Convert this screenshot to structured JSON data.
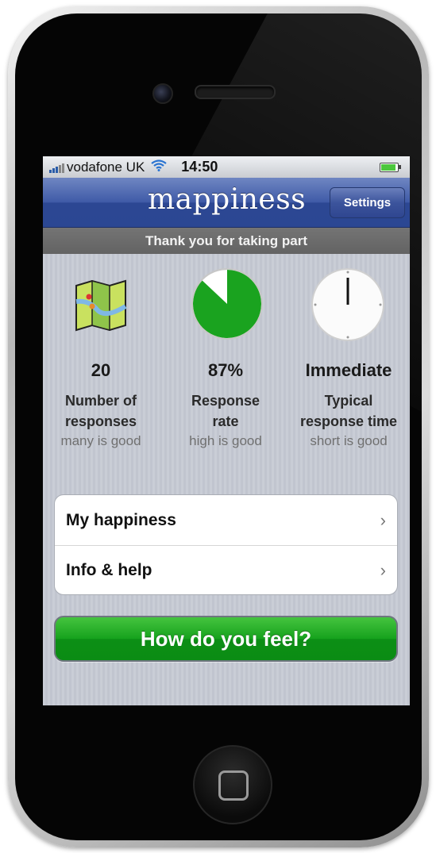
{
  "status_bar": {
    "carrier": "vodafone UK",
    "time": "14:50",
    "wifi_icon": "wifi-icon",
    "signal_icon": "signal-bars-icon",
    "battery_icon": "battery-icon",
    "battery_level": 0.9
  },
  "header": {
    "title": "mappiness",
    "settings_label": "Settings"
  },
  "banner": {
    "text": "Thank you for taking part"
  },
  "stats": [
    {
      "icon": "map-icon",
      "value": "20",
      "label_line1": "Number of",
      "label_line2": "responses",
      "hint": "many is good"
    },
    {
      "icon": "pie-chart-icon",
      "value": "87%",
      "label_line1": "Response",
      "label_line2": "rate",
      "hint": "high is good",
      "fill_fraction": 0.87
    },
    {
      "icon": "clock-icon",
      "value": "Immediate",
      "label_line1": "Typical",
      "label_line2": "response time",
      "hint": "short is good"
    }
  ],
  "menu": {
    "items": [
      {
        "label": "My happiness",
        "icon": "chevron-right-icon"
      },
      {
        "label": "Info & help",
        "icon": "chevron-right-icon"
      }
    ]
  },
  "cta": {
    "label": "How do you feel?"
  },
  "colors": {
    "nav_blue": "#3f5aa7",
    "cta_green": "#16a21d",
    "banner_gray": "#6b6b6b"
  },
  "icons": {
    "chevron": "›"
  }
}
